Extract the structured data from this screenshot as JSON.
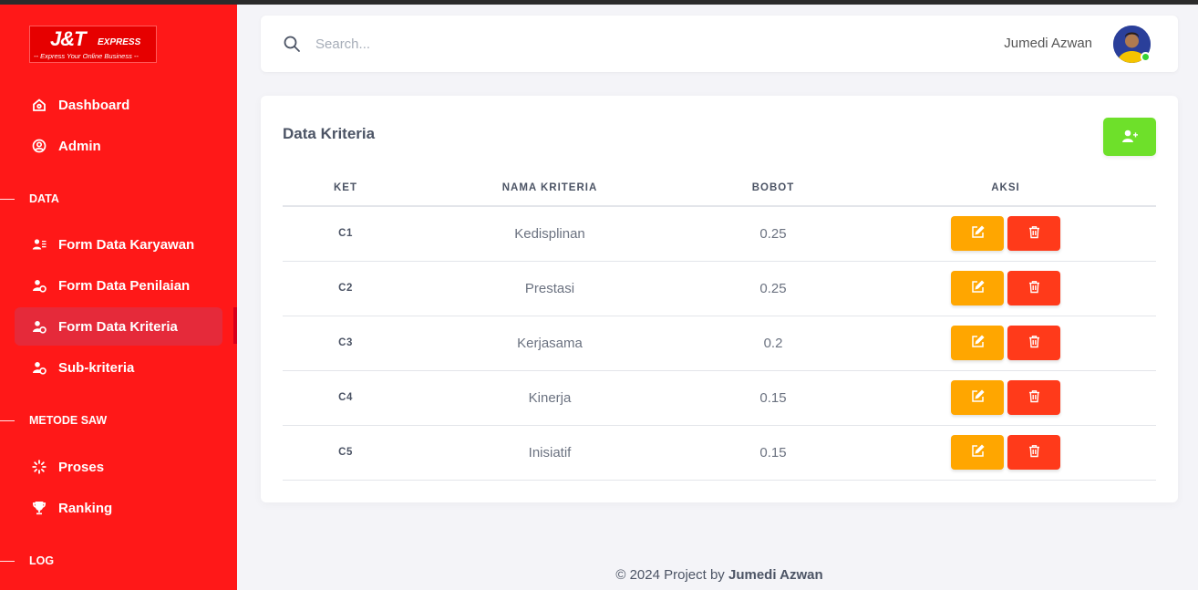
{
  "brand": {
    "logo_main": "J&T",
    "logo_express": "EXPRESS",
    "logo_tagline": "-- Express Your Online Business --"
  },
  "sidebar": {
    "items": [
      {
        "label": "Dashboard",
        "icon": "home-icon"
      },
      {
        "label": "Admin",
        "icon": "user-circle-icon"
      }
    ],
    "sections": [
      {
        "label": "DATA"
      },
      {
        "label": "METODE SAW"
      },
      {
        "label": "LOG"
      }
    ],
    "data_items": [
      {
        "label": "Form Data Karyawan",
        "icon": "user-list-icon"
      },
      {
        "label": "Form Data Penilaian",
        "icon": "user-gear-icon"
      },
      {
        "label": "Form Data Kriteria",
        "icon": "user-gear-icon",
        "active": true
      },
      {
        "label": "Sub-kriteria",
        "icon": "user-gear-icon"
      }
    ],
    "saw_items": [
      {
        "label": "Proses",
        "icon": "spinner-icon"
      },
      {
        "label": "Ranking",
        "icon": "trophy-icon"
      }
    ]
  },
  "topbar": {
    "search_placeholder": "Search...",
    "username": "Jumedi Azwan"
  },
  "card": {
    "title": "Data Kriteria",
    "columns": [
      "KET",
      "NAMA KRITERIA",
      "BOBOT",
      "AKSI"
    ],
    "rows": [
      {
        "ket": "C1",
        "nama": "Kedisplinan",
        "bobot": "0.25"
      },
      {
        "ket": "C2",
        "nama": "Prestasi",
        "bobot": "0.25"
      },
      {
        "ket": "C3",
        "nama": "Kerjasama",
        "bobot": "0.2"
      },
      {
        "ket": "C4",
        "nama": "Kinerja",
        "bobot": "0.15"
      },
      {
        "ket": "C5",
        "nama": "Inisiatif",
        "bobot": "0.15"
      }
    ]
  },
  "footer": {
    "prefix": "© 2024 Project by",
    "author": "Jumedi Azwan"
  },
  "colors": {
    "sidebar": "#ff1818",
    "active_item": "#e52a3a",
    "add_button": "#6ee02a",
    "edit_button": "#ffa600",
    "delete_button": "#ff3a1a"
  }
}
